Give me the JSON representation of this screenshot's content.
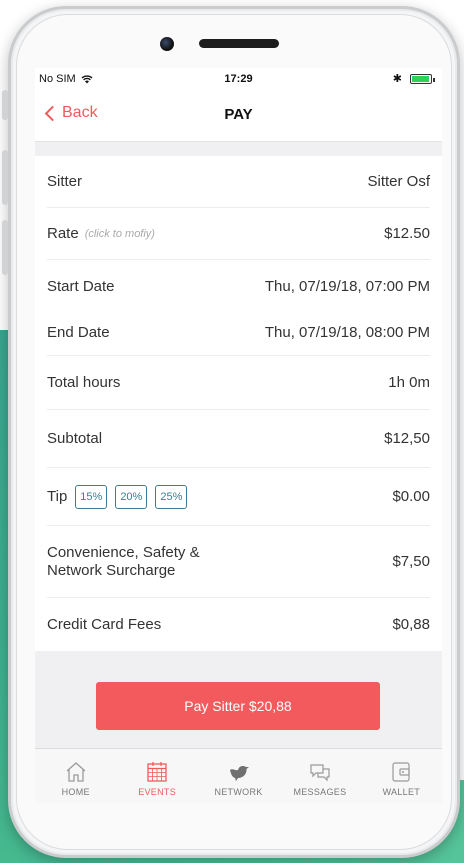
{
  "status_bar": {
    "carrier": "No SIM",
    "time": "17:29",
    "bluetooth": "✱"
  },
  "nav": {
    "back_label": "Back",
    "title": "PAY"
  },
  "rows": {
    "sitter": {
      "label": "Sitter",
      "value": "Sitter Osf"
    },
    "rate": {
      "label": "Rate",
      "hint": "(click to mofiy)",
      "value": "$12.50"
    },
    "start_date": {
      "label": "Start Date",
      "value": "Thu, 07/19/18, 07:00 PM"
    },
    "end_date": {
      "label": "End Date",
      "value": "Thu, 07/19/18, 08:00 PM"
    },
    "total_hours": {
      "label": "Total hours",
      "value": "1h 0m"
    },
    "subtotal": {
      "label": "Subtotal",
      "value": "$12,50"
    },
    "tip": {
      "label": "Tip",
      "options": [
        "15%",
        "20%",
        "25%"
      ],
      "value": "$0.00"
    },
    "surcharge": {
      "label_line1": "Convenience, Safety &",
      "label_line2": "Network Surcharge",
      "value": "$7,50"
    },
    "card_fees": {
      "label": "Credit Card Fees",
      "value": "$0,88"
    }
  },
  "pay_button": {
    "label": "Pay Sitter $20,88"
  },
  "tabs": [
    {
      "label": "HOME",
      "icon": "home-icon"
    },
    {
      "label": "EVENTS",
      "icon": "calendar-icon",
      "active": true
    },
    {
      "label": "NETWORK",
      "icon": "bird-icon"
    },
    {
      "label": "MESSAGES",
      "icon": "chat-icon"
    },
    {
      "label": "WALLET",
      "icon": "wallet-icon"
    }
  ],
  "colors": {
    "accent": "#f25a5e",
    "tip_border": "#3a7f95",
    "background_teal": "#3eb08f"
  }
}
